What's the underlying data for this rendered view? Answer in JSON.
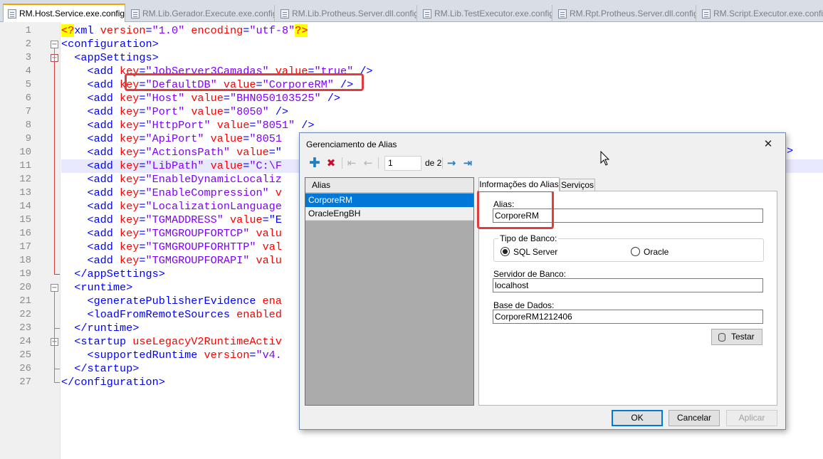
{
  "tabs": [
    {
      "label": "RM.Host.Service.exe.config",
      "active": true
    },
    {
      "label": "RM.Lib.Gerador.Execute.exe.config",
      "active": false
    },
    {
      "label": "RM.Lib.Protheus.Server.dll.config",
      "active": false
    },
    {
      "label": "RM.Lib.TestExecutor.exe.config",
      "active": false
    },
    {
      "label": "RM.Rpt.Protheus.Server.dll.config",
      "active": false
    },
    {
      "label": "RM.Script.Executor.exe.config",
      "active": false
    }
  ],
  "editor": {
    "line_numbers": [
      "1",
      "2",
      "3",
      "4",
      "5",
      "6",
      "7",
      "8",
      "9",
      "10",
      "11",
      "12",
      "13",
      "14",
      "15",
      "16",
      "17",
      "18",
      "19",
      "20",
      "21",
      "22",
      "23",
      "24",
      "25",
      "26",
      "27"
    ],
    "current_line": 11,
    "lines": [
      [
        {
          "t": "pi",
          "v": "<?"
        },
        {
          "t": "tag",
          "v": "xml "
        },
        {
          "t": "att",
          "v": "version"
        },
        {
          "t": "tag",
          "v": "="
        },
        {
          "t": "val",
          "v": "\"1.0\""
        },
        {
          "t": "tag",
          "v": " "
        },
        {
          "t": "att",
          "v": "encoding"
        },
        {
          "t": "tag",
          "v": "="
        },
        {
          "t": "val",
          "v": "\"utf-8\""
        },
        {
          "t": "pi",
          "v": "?>"
        }
      ],
      [
        {
          "t": "tag",
          "v": "<configuration>"
        }
      ],
      [
        {
          "t": "tag",
          "v": "  <appSettings>"
        }
      ],
      [
        {
          "t": "tag",
          "v": "    <add "
        },
        {
          "t": "att",
          "v": "key"
        },
        {
          "t": "tag",
          "v": "="
        },
        {
          "t": "val",
          "v": "\"JobServer3Camadas\""
        },
        {
          "t": "tag",
          "v": " "
        },
        {
          "t": "att",
          "v": "value"
        },
        {
          "t": "tag",
          "v": "="
        },
        {
          "t": "val",
          "v": "\"true\""
        },
        {
          "t": "tag",
          "v": " />"
        }
      ],
      [
        {
          "t": "tag",
          "v": "    <add "
        },
        {
          "t": "att",
          "v": "key"
        },
        {
          "t": "tag",
          "v": "="
        },
        {
          "t": "val",
          "v": "\"DefaultDB\""
        },
        {
          "t": "tag",
          "v": " "
        },
        {
          "t": "att",
          "v": "value"
        },
        {
          "t": "tag",
          "v": "="
        },
        {
          "t": "val",
          "v": "\"CorporeRM\""
        },
        {
          "t": "tag",
          "v": " />"
        }
      ],
      [
        {
          "t": "tag",
          "v": "    <add "
        },
        {
          "t": "att",
          "v": "key"
        },
        {
          "t": "tag",
          "v": "="
        },
        {
          "t": "val",
          "v": "\"Host\""
        },
        {
          "t": "tag",
          "v": " "
        },
        {
          "t": "att",
          "v": "value"
        },
        {
          "t": "tag",
          "v": "="
        },
        {
          "t": "val",
          "v": "\"BHN050103525\""
        },
        {
          "t": "tag",
          "v": " />"
        }
      ],
      [
        {
          "t": "tag",
          "v": "    <add "
        },
        {
          "t": "att",
          "v": "key"
        },
        {
          "t": "tag",
          "v": "="
        },
        {
          "t": "val",
          "v": "\"Port\""
        },
        {
          "t": "tag",
          "v": " "
        },
        {
          "t": "att",
          "v": "value"
        },
        {
          "t": "tag",
          "v": "="
        },
        {
          "t": "val",
          "v": "\"8050\""
        },
        {
          "t": "tag",
          "v": " />"
        }
      ],
      [
        {
          "t": "tag",
          "v": "    <add "
        },
        {
          "t": "att",
          "v": "key"
        },
        {
          "t": "tag",
          "v": "="
        },
        {
          "t": "val",
          "v": "\"HttpPort\""
        },
        {
          "t": "tag",
          "v": " "
        },
        {
          "t": "att",
          "v": "value"
        },
        {
          "t": "tag",
          "v": "="
        },
        {
          "t": "val",
          "v": "\"8051\""
        },
        {
          "t": "tag",
          "v": " />"
        }
      ],
      [
        {
          "t": "tag",
          "v": "    <add "
        },
        {
          "t": "att",
          "v": "key"
        },
        {
          "t": "tag",
          "v": "="
        },
        {
          "t": "val",
          "v": "\"ApiPort\""
        },
        {
          "t": "tag",
          "v": " "
        },
        {
          "t": "att",
          "v": "value"
        },
        {
          "t": "tag",
          "v": "="
        },
        {
          "t": "val",
          "v": "\"8051"
        }
      ],
      [
        {
          "t": "tag",
          "v": "    <add "
        },
        {
          "t": "att",
          "v": "key"
        },
        {
          "t": "tag",
          "v": "="
        },
        {
          "t": "val",
          "v": "\"ActionsPath\""
        },
        {
          "t": "tag",
          "v": " "
        },
        {
          "t": "att",
          "v": "value"
        },
        {
          "t": "tag",
          "v": "=\""
        }
      ],
      [
        {
          "t": "tag",
          "v": "    <add "
        },
        {
          "t": "att",
          "v": "key"
        },
        {
          "t": "tag",
          "v": "="
        },
        {
          "t": "val",
          "v": "\"LibPath\""
        },
        {
          "t": "tag",
          "v": " "
        },
        {
          "t": "att",
          "v": "value"
        },
        {
          "t": "tag",
          "v": "="
        },
        {
          "t": "val",
          "v": "\"C:\\F"
        }
      ],
      [
        {
          "t": "tag",
          "v": "    <add "
        },
        {
          "t": "att",
          "v": "key"
        },
        {
          "t": "tag",
          "v": "="
        },
        {
          "t": "val",
          "v": "\"EnableDynamicLocaliz"
        }
      ],
      [
        {
          "t": "tag",
          "v": "    <add "
        },
        {
          "t": "att",
          "v": "key"
        },
        {
          "t": "tag",
          "v": "="
        },
        {
          "t": "val",
          "v": "\"EnableCompression\""
        },
        {
          "t": "tag",
          "v": " "
        },
        {
          "t": "att",
          "v": "v"
        }
      ],
      [
        {
          "t": "tag",
          "v": "    <add "
        },
        {
          "t": "att",
          "v": "key"
        },
        {
          "t": "tag",
          "v": "="
        },
        {
          "t": "val",
          "v": "\"LocalizationLanguage"
        }
      ],
      [
        {
          "t": "tag",
          "v": "    <add "
        },
        {
          "t": "att",
          "v": "key"
        },
        {
          "t": "tag",
          "v": "="
        },
        {
          "t": "val",
          "v": "\"TGMADDRESS\""
        },
        {
          "t": "tag",
          "v": " "
        },
        {
          "t": "att",
          "v": "value"
        },
        {
          "t": "tag",
          "v": "=\"E"
        }
      ],
      [
        {
          "t": "tag",
          "v": "    <add "
        },
        {
          "t": "att",
          "v": "key"
        },
        {
          "t": "tag",
          "v": "="
        },
        {
          "t": "val",
          "v": "\"TGMGROUPFORTCP\""
        },
        {
          "t": "tag",
          "v": " "
        },
        {
          "t": "att",
          "v": "valu"
        }
      ],
      [
        {
          "t": "tag",
          "v": "    <add "
        },
        {
          "t": "att",
          "v": "key"
        },
        {
          "t": "tag",
          "v": "="
        },
        {
          "t": "val",
          "v": "\"TGMGROUPFORHTTP\""
        },
        {
          "t": "tag",
          "v": " "
        },
        {
          "t": "att",
          "v": "val"
        }
      ],
      [
        {
          "t": "tag",
          "v": "    <add "
        },
        {
          "t": "att",
          "v": "key"
        },
        {
          "t": "tag",
          "v": "="
        },
        {
          "t": "val",
          "v": "\"TGMGROUPFORAPI\""
        },
        {
          "t": "tag",
          "v": " "
        },
        {
          "t": "att",
          "v": "valu"
        }
      ],
      [
        {
          "t": "tag",
          "v": "  </appSettings>"
        }
      ],
      [
        {
          "t": "tag",
          "v": "  <runtime>"
        }
      ],
      [
        {
          "t": "tag",
          "v": "    <"
        },
        {
          "t": "tag",
          "v": "generatePublisherEvidence "
        },
        {
          "t": "att",
          "v": "ena"
        }
      ],
      [
        {
          "t": "tag",
          "v": "    <"
        },
        {
          "t": "tag",
          "v": "loadFromRemoteSources "
        },
        {
          "t": "att",
          "v": "enabled"
        }
      ],
      [
        {
          "t": "tag",
          "v": "  </runtime>"
        }
      ],
      [
        {
          "t": "tag",
          "v": "  <startup "
        },
        {
          "t": "att",
          "v": "useLegacyV2RuntimeActiv"
        }
      ],
      [
        {
          "t": "tag",
          "v": "    <supportedRuntime "
        },
        {
          "t": "att",
          "v": "version"
        },
        {
          "t": "tag",
          "v": "="
        },
        {
          "t": "val",
          "v": "\"v4."
        }
      ],
      [
        {
          "t": "tag",
          "v": "  </startup>"
        }
      ],
      [
        {
          "t": "tag",
          "v": "</configuration>"
        }
      ]
    ],
    "edge_fragment": ">"
  },
  "dialog": {
    "title": "Gerenciamento de Alias",
    "close_glyph": "✕",
    "navigator": {
      "add_glyph": "✚",
      "delete_glyph": "✖",
      "first_glyph": "⇤",
      "prev_glyph": "←",
      "position": "1",
      "of_label": "de 2",
      "next_glyph": "→",
      "last_glyph": "⇥"
    },
    "list": {
      "header": "Alias",
      "items": [
        "CorporeRM",
        "OracleEngBH"
      ],
      "selected_index": 0
    },
    "tabs": {
      "info_label": "Informações do Alias",
      "services_label": "Serviços"
    },
    "form": {
      "alias_label": "Alias:",
      "alias_value": "CorporeRM",
      "db_type_legend": "Tipo de Banco:",
      "opt_sqlserver": "SQL Server",
      "opt_oracle": "Oracle",
      "db_type_selected": "SQL Server",
      "server_label": "Servidor de Banco:",
      "server_value": "localhost",
      "database_label": "Base de Dados:",
      "database_value": "CorporeRM1212406",
      "test_label": "Testar"
    },
    "buttons": {
      "ok": "OK",
      "cancel": "Cancelar",
      "apply": "Aplicar"
    }
  },
  "colors": {
    "tag": "#0000ff",
    "attribute": "#ff0000",
    "value": "#8000ff",
    "highlight_box": "#e03c3c",
    "selection": "#0078d7"
  }
}
